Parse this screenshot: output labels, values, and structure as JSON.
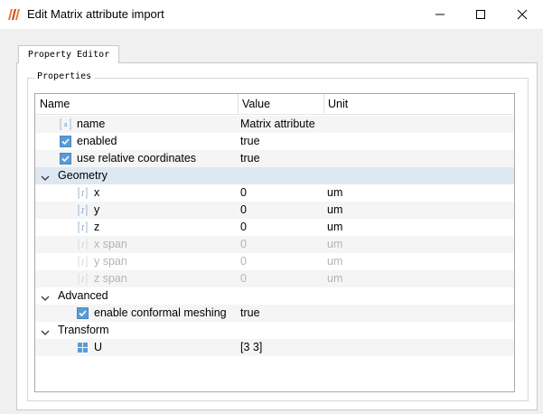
{
  "window": {
    "title": "Edit Matrix attribute import"
  },
  "tabs": [
    {
      "label": "Property Editor"
    }
  ],
  "group": {
    "title": "Properties"
  },
  "columns": {
    "name": "Name",
    "value": "Value",
    "unit": "Unit"
  },
  "rows": [
    {
      "name": "name",
      "value": "Matrix attribute",
      "unit": "",
      "icon": "text-field-icon"
    },
    {
      "name": "enabled",
      "value": "true",
      "unit": "",
      "icon": "checked-checkbox-icon"
    },
    {
      "name": "use relative coordinates",
      "value": "true",
      "unit": "",
      "icon": "checked-checkbox-icon"
    },
    {
      "name": "Geometry",
      "icon": "chevron-down-icon"
    },
    {
      "name": "x",
      "value": "0",
      "unit": "um",
      "icon": "number-field-icon"
    },
    {
      "name": "y",
      "value": "0",
      "unit": "um",
      "icon": "number-field-icon"
    },
    {
      "name": "z",
      "value": "0",
      "unit": "um",
      "icon": "number-field-icon"
    },
    {
      "name": "x span",
      "value": "0",
      "unit": "um",
      "icon": "number-field-icon"
    },
    {
      "name": "y span",
      "value": "0",
      "unit": "um",
      "icon": "number-field-icon"
    },
    {
      "name": "z span",
      "value": "0",
      "unit": "um",
      "icon": "number-field-icon"
    },
    {
      "name": "Advanced",
      "icon": "chevron-down-icon"
    },
    {
      "name": "enable conformal meshing",
      "value": "true",
      "unit": "",
      "icon": "checked-checkbox-icon"
    },
    {
      "name": "Transform",
      "icon": "chevron-down-icon"
    },
    {
      "name": "U",
      "value": "[3 3]",
      "unit": "",
      "icon": "matrix-grid-icon"
    }
  ],
  "colors": {
    "selected_row": "#dde8f3",
    "alt_row": "#f5f5f5",
    "checkbox": "#5b9bd5",
    "disabled_text": "#b4b4b4",
    "app_icon": "#e8792b"
  }
}
